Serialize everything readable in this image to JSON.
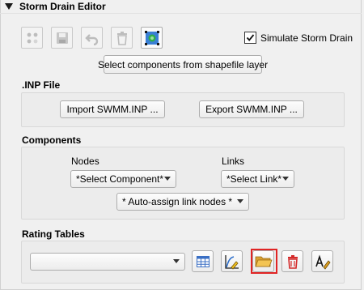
{
  "panel": {
    "title": "Storm Drain Editor"
  },
  "toolbar": {
    "icons": [
      "nodes-icon",
      "save-icon",
      "undo-icon",
      "delete-icon",
      "select-area-icon"
    ],
    "simulate_label": "Simulate Storm Drain",
    "simulate_checked": true,
    "select_shapefile_label": "Select components from shapefile layer"
  },
  "inp_file": {
    "heading": ".INP File",
    "import_label": "Import SWMM.INP ...",
    "export_label": "Export SWMM.INP ..."
  },
  "components": {
    "heading": "Components",
    "nodes_label": "Nodes",
    "links_label": "Links",
    "nodes_value": "*Select Component*",
    "links_value": "*Select Link*",
    "auto_assign_value": "* Auto-assign link nodes *"
  },
  "rating_tables": {
    "heading": "Rating Tables",
    "selected_value": "",
    "buttons": [
      "table-icon",
      "edit-curve-icon",
      "open-folder-icon",
      "delete-icon",
      "rename-icon"
    ],
    "highlight_color": "#e02424"
  }
}
